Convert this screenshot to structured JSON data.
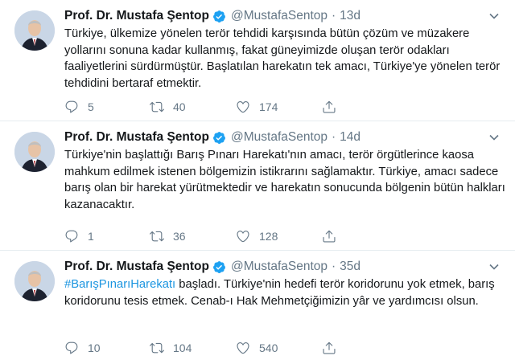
{
  "tweets": [
    {
      "name": "Prof. Dr. Mustafa Şentop",
      "handle": "@MustafaSentop",
      "separator": "·",
      "time": "13d",
      "hashtag": "",
      "text": "Türkiye, ülkemize yönelen terör tehdidi karşısında bütün çözüm ve müzakere yollarını sonuna kadar kullanmış, fakat güneyimizde oluşan terör odakları faaliyetlerini sürdürmüştür. Başlatılan harekatın tek amacı, Türkiye'ye yönelen terör tehdidini bertaraf etmektir.",
      "reply_count": "5",
      "retweet_count": "40",
      "like_count": "174"
    },
    {
      "name": "Prof. Dr. Mustafa Şentop",
      "handle": "@MustafaSentop",
      "separator": "·",
      "time": "14d",
      "hashtag": "",
      "text": "Türkiye'nin başlattığı Barış Pınarı Harekatı'nın amacı, terör örgütlerince kaosa mahkum edilmek istenen bölgemizin istikrarını sağlamaktır. Türkiye, amacı sadece barış olan bir harekat yürütmektedir ve harekatın sonucunda bölgenin bütün halkları kazanacaktır.",
      "reply_count": "1",
      "retweet_count": "36",
      "like_count": "128"
    },
    {
      "name": "Prof. Dr. Mustafa Şentop",
      "handle": "@MustafaSentop",
      "separator": "·",
      "time": "35d",
      "hashtag": "#BarışPınarıHarekatı",
      "text": " başladı. Türkiye'nin hedefi terör koridorunu yok etmek, barış koridorunu tesis etmek. Cenab-ı Hak Mehmetçiğimizin yâr ve yardımcısı olsun.",
      "reply_count": "10",
      "retweet_count": "104",
      "like_count": "540"
    }
  ],
  "colors": {
    "verified": "#1da1f2",
    "hashtag": "#1b95e0",
    "secondary_text": "#657786",
    "divider": "#e6ecf0"
  },
  "icons": [
    "verified-badge-icon",
    "caret-down-icon",
    "reply-icon",
    "retweet-icon",
    "like-icon",
    "share-icon"
  ]
}
